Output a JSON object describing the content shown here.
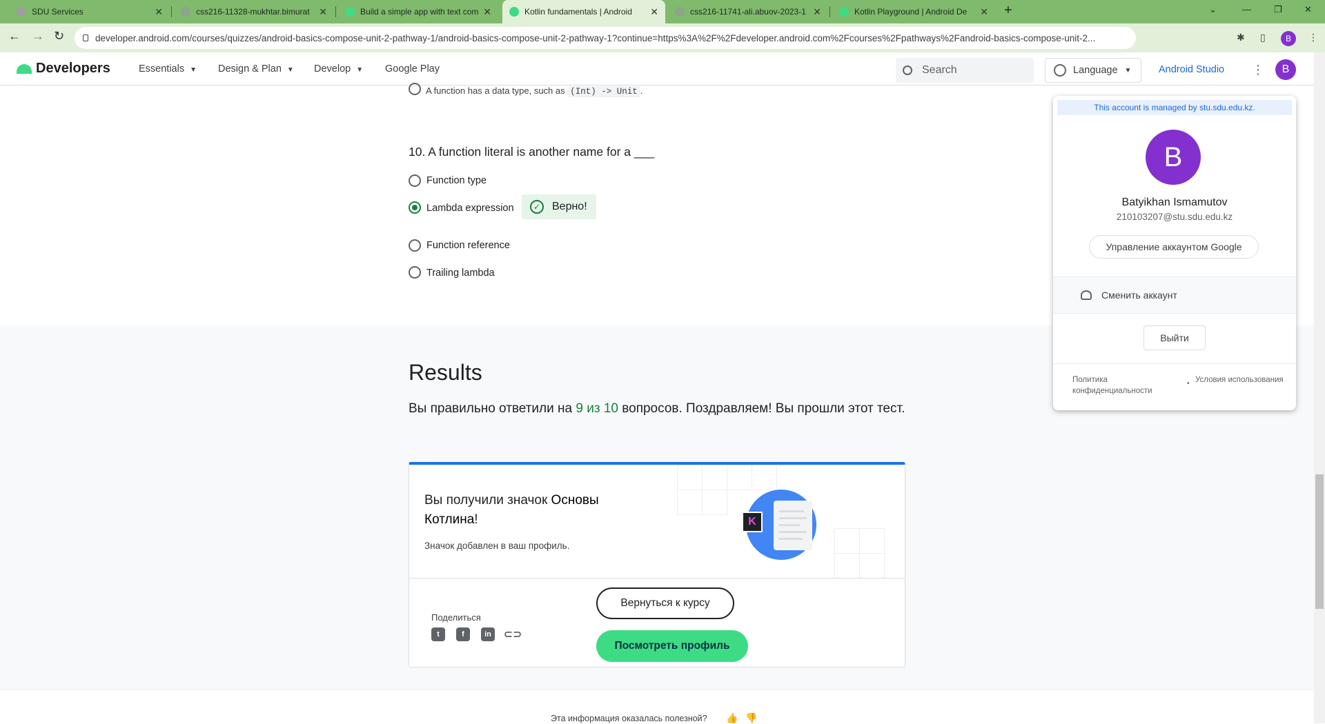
{
  "browser": {
    "tabs": [
      {
        "title": "SDU Services",
        "color": "#9e9e9e",
        "active": false
      },
      {
        "title": "css216-11328-mukhtar.bimurat",
        "color": "#8fa38a",
        "active": false
      },
      {
        "title": "Build a simple app with text com",
        "color": "#3ddc84",
        "active": false
      },
      {
        "title": "Kotlin fundamentals | Android",
        "color": "#3ddc84",
        "active": true
      },
      {
        "title": "css216-11741-ali.abuov-2023-1",
        "color": "#8fa38a",
        "active": false
      },
      {
        "title": "Kotlin Playground | Android De",
        "color": "#3ddc84",
        "active": false
      }
    ],
    "close_glyph": "✕",
    "new_tab_glyph": "+",
    "url": "developer.android.com/courses/quizzes/android-basics-compose-unit-2-pathway-1/android-basics-compose-unit-2-pathway-1?continue=https%3A%2F%2Fdeveloper.android.com%2Fcourses%2Fpathways%2Fandroid-basics-compose-unit-2...",
    "profile_initial": "B"
  },
  "site": {
    "logo_text": "Developers",
    "nav": [
      "Essentials",
      "Design & Plan",
      "Develop",
      "Google Play"
    ],
    "search_placeholder": "Search",
    "language_label": "Language",
    "studio_link": "Android Studio",
    "avatar_initial": "B"
  },
  "quiz": {
    "prev_option_text": "A function has a data type, such as",
    "prev_option_code": "(Int) -> Unit",
    "prev_option_end": ".",
    "question": "10. A function literal is another name for a ___",
    "options": [
      {
        "label": "Function type",
        "selected": false
      },
      {
        "label": "Lambda expression",
        "selected": true
      },
      {
        "label": "Function reference",
        "selected": false
      },
      {
        "label": "Trailing lambda",
        "selected": false
      }
    ],
    "feedback": "Верно!",
    "feedback_icon": "check-circle-icon"
  },
  "results": {
    "title": "Results",
    "text_before": "Вы правильно ответили на",
    "score": "9 из 10",
    "text_after": "вопросов. Поздравляем! Вы прошли этот тест.",
    "card": {
      "title_plain": "Вы получили значок",
      "title_strong": "Основы Котлина",
      "title_end": "!",
      "subtitle": "Значок добавлен в ваш профиль.",
      "badge_letter": "K",
      "share_label": "Поделиться",
      "share_icons": [
        "twitter-icon",
        "facebook-icon",
        "linkedin-icon",
        "link-icon"
      ],
      "back_button": "Вернуться к курсу",
      "profile_button": "Посмотреть профиль"
    },
    "feedback_question": "Эта информация оказалась полезной?"
  },
  "account": {
    "managed_notice": "This account is managed by stu.sdu.edu.kz.",
    "initial": "B",
    "name": "Batyikhan Ismamutov",
    "email": "210103207@stu.sdu.edu.kz",
    "manage_button": "Управление аккаунтом Google",
    "switch_account": "Сменить аккаунт",
    "logout": "Выйти",
    "privacy": "Политика конфиденциальности",
    "terms": "Условия использования"
  }
}
